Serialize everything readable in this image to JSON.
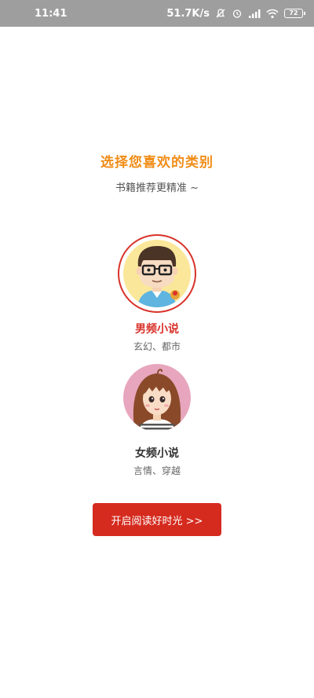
{
  "status_bar": {
    "time": "11:41",
    "network_speed": "51.7K/s",
    "battery": "72",
    "icons": [
      "mute-bell-icon",
      "alarm-icon",
      "signal-icon",
      "wifi-icon",
      "battery-icon"
    ]
  },
  "header": {
    "title": "选择您喜欢的类别",
    "subtitle": "书籍推荐更精准 ~"
  },
  "options": [
    {
      "name": "男频小说",
      "desc": "玄幻、都市",
      "selected": true,
      "icon": "boy-avatar-icon"
    },
    {
      "name": "女频小说",
      "desc": "言情、穿越",
      "selected": false,
      "icon": "girl-avatar-icon"
    }
  ],
  "action": {
    "start_label": "开启阅读好时光 >>"
  },
  "colors": {
    "accent_orange": "#f08c16",
    "brand_red": "#d52b1f",
    "status_bar_bg": "#9e9e9e"
  }
}
